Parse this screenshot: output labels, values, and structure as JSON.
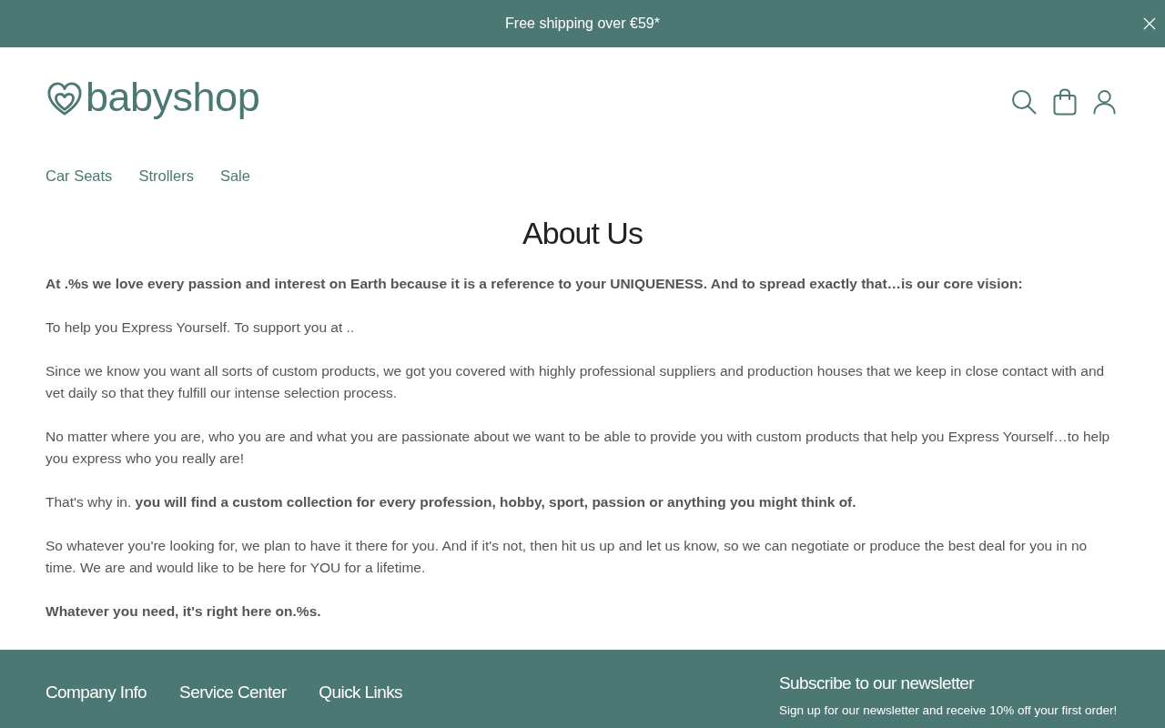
{
  "announcement_bar": {
    "text": "Free shipping over €59*"
  },
  "header": {
    "logo": {
      "text": "babyshop"
    }
  },
  "nav": [
    {
      "label": "Car Seats"
    },
    {
      "label": "Strollers"
    },
    {
      "label": "Sale"
    }
  ],
  "page": {
    "title": "About Us",
    "paragraphs": [
      {
        "text": "At .%s we love every passion and interest on Earth because it is a reference to your UNIQUENESS. And to spread exactly that…is our core vision:",
        "bold": true
      },
      {
        "text": "To help you Express Yourself. To support you at ..",
        "bold": false
      },
      {
        "text": "Since we know you want all sorts of custom products, we got you covered with highly professional suppliers and production houses that we keep in close contact with and vet daily so that they fulfill our intense selection process.",
        "bold": false
      },
      {
        "text": "No matter where you are, who you are and what you are passionate about we want to be able to provide you with custom products that help you Express Yourself…to help you express who you really are!",
        "bold": false
      },
      {
        "text": "That's why in. **you will find a custom collection for every profession, hobby, sport, passion or anything you might think of.**",
        "bold": false
      },
      {
        "text": "So whatever you're looking for, we plan to have it there for you. And if it's not, then hit us up and let us know, so we can negotiate or produce the best deal for you in no time. We are and would like to be here for YOU for a lifetime.",
        "bold": false
      },
      {
        "text": "Whatever you need, it's right here on.%s.",
        "bold": true
      }
    ]
  },
  "footer": {
    "columns": [
      {
        "heading": "Company Info"
      },
      {
        "heading": "Service Center"
      },
      {
        "heading": "Quick Links"
      }
    ],
    "newsletter": {
      "heading": "Subscribe to our newsletter",
      "text": "Sign up for our newsletter and receive 10% off your first order!"
    }
  }
}
